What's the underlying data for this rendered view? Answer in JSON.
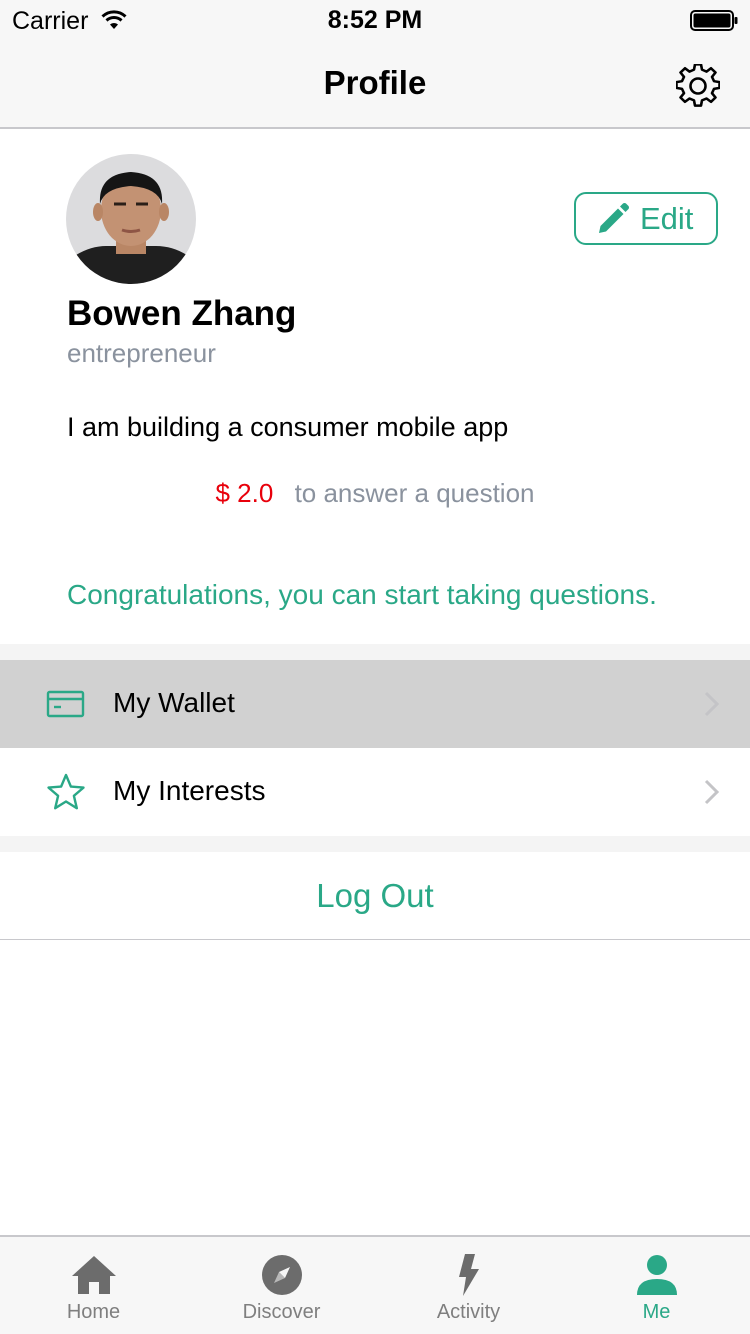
{
  "status_bar": {
    "carrier": "Carrier",
    "time": "8:52 PM"
  },
  "nav": {
    "title": "Profile"
  },
  "profile": {
    "name": "Bowen Zhang",
    "title": "entrepreneur",
    "about": "I am building a consumer mobile app",
    "rate_price": "$ 2.0",
    "rate_text": "to answer a question",
    "congrats": "Congratulations, you can start taking questions.",
    "edit_label": "Edit"
  },
  "menu": [
    {
      "label": "My Wallet",
      "icon": "wallet-icon"
    },
    {
      "label": "My Interests",
      "icon": "star-icon"
    }
  ],
  "logout_label": "Log Out",
  "tabs": [
    {
      "label": "Home",
      "icon": "home-icon",
      "active": false
    },
    {
      "label": "Discover",
      "icon": "compass-icon",
      "active": false
    },
    {
      "label": "Activity",
      "icon": "lightning-icon",
      "active": false
    },
    {
      "label": "Me",
      "icon": "person-icon",
      "active": true
    }
  ],
  "colors": {
    "accent": "#2aa887",
    "price": "#e8000b",
    "secondary_text": "#8a929e"
  }
}
